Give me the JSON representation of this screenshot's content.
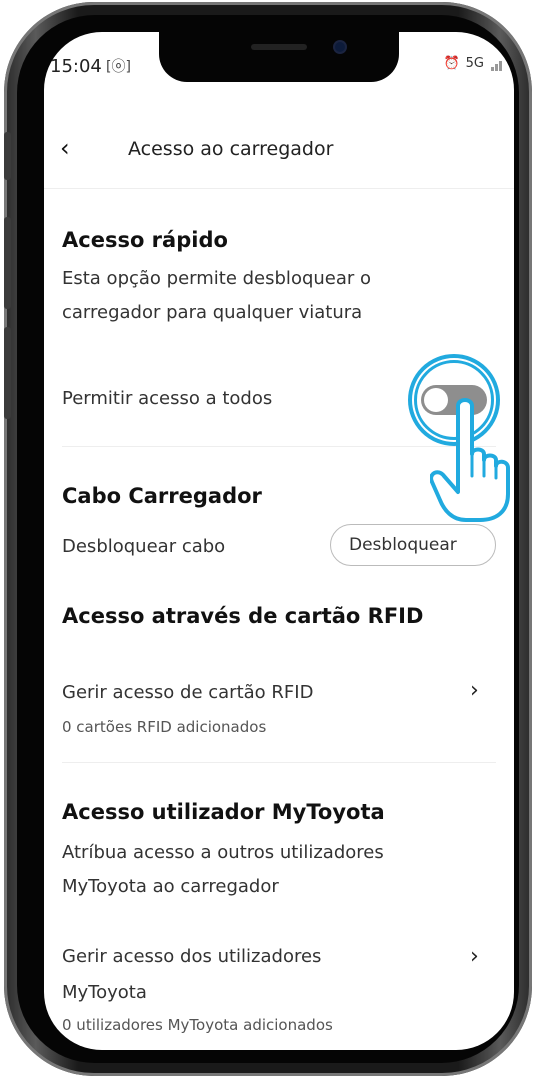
{
  "status": {
    "time": "15:04",
    "scan_icon": "screenshot-icon",
    "network": "5G"
  },
  "header": {
    "title": "Acesso ao carregador",
    "back_icon": "chevron-left-icon"
  },
  "quick_access": {
    "title": "Acesso rápido",
    "description_line1": "Esta opção permite desbloquear o",
    "description_line2": "carregador para qualquer viatura",
    "toggle_label": "Permitir acesso a todos",
    "toggle_on": false
  },
  "cable": {
    "title": "Cabo Carregador",
    "label": "Desbloquear cabo",
    "button_label": "Desbloquear"
  },
  "rfid": {
    "title": "Acesso através de cartão RFID",
    "manage_label": "Gerir acesso de cartão RFID",
    "count_label": "0 cartões RFID adicionados"
  },
  "mytoyota": {
    "title": "Acesso utilizador MyToyota",
    "description_line1": "Atríbua acesso a outros utilizadores",
    "description_line2": "MyToyota ao carregador",
    "manage_line1": "Gerir acesso dos utilizadores",
    "manage_line2": "MyToyota",
    "count_label": "0 utilizadores MyToyota adicionados"
  },
  "colors": {
    "accent": "#21aadf",
    "toggle_off": "#8e8e8e"
  }
}
